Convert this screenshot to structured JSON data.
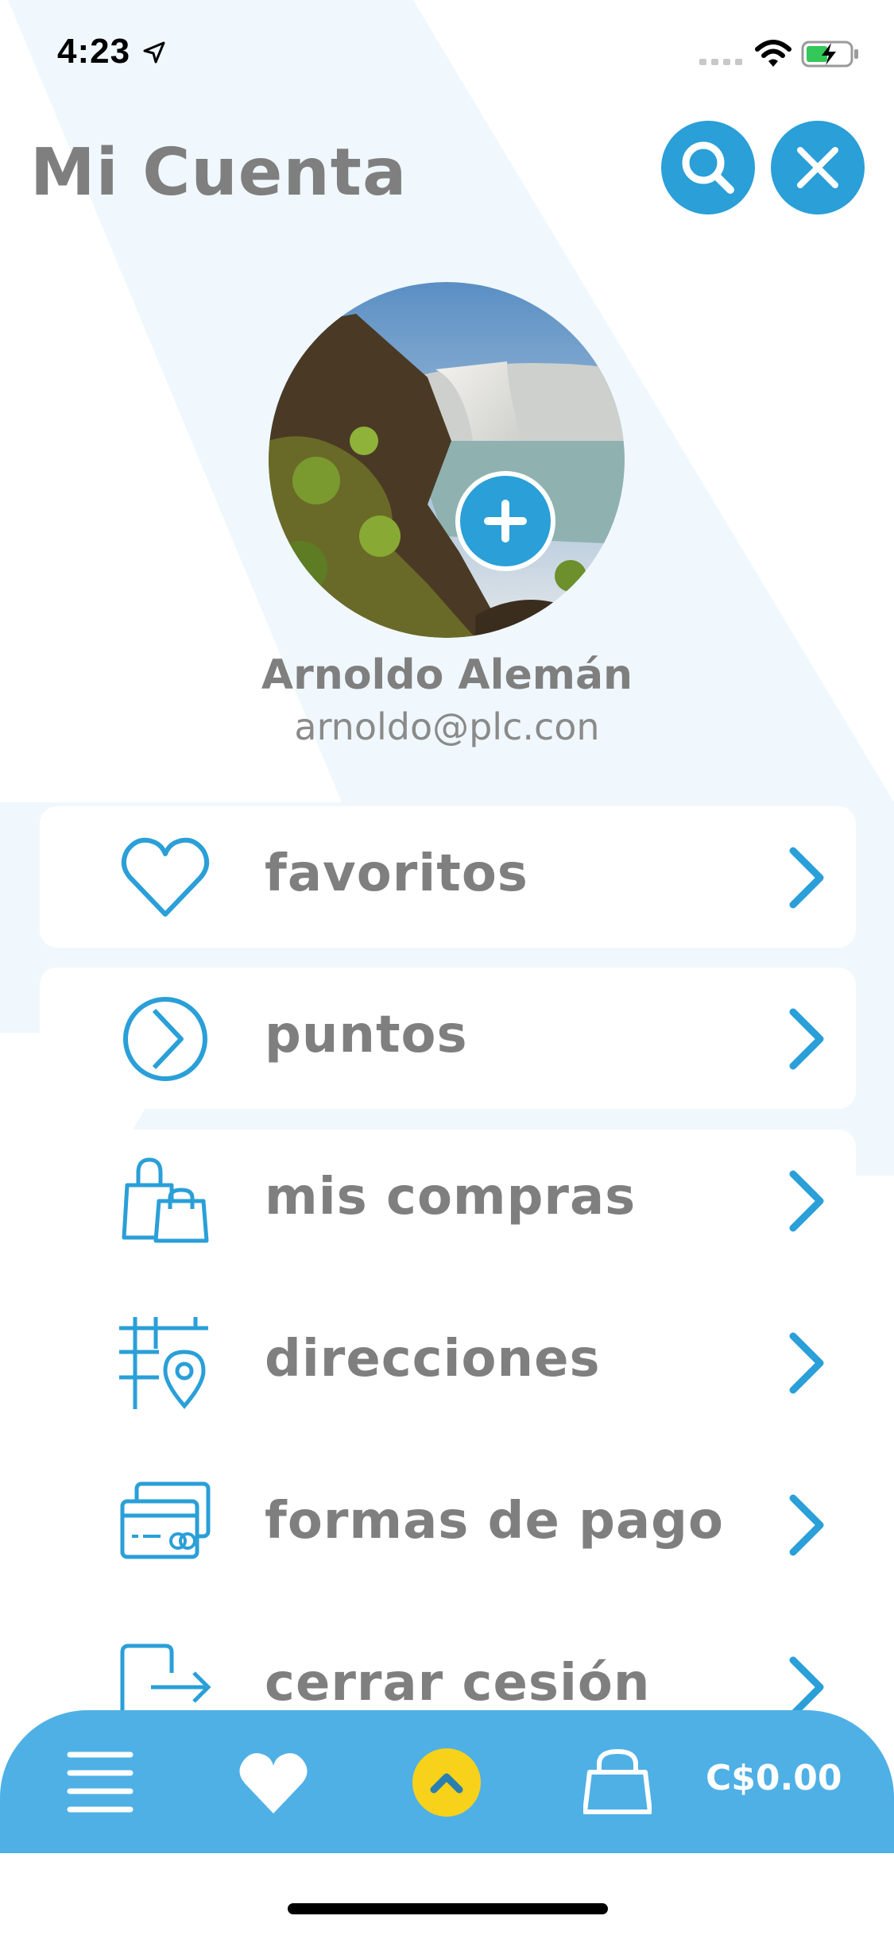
{
  "status_bar": {
    "time": "4:23"
  },
  "header": {
    "title": "Mi Cuenta"
  },
  "profile": {
    "name": "Arnoldo Alemán",
    "email": "arnoldo@plc.con"
  },
  "menu": [
    {
      "label": "favoritos",
      "icon": "heart-outline-icon"
    },
    {
      "label": "puntos",
      "icon": "points-circle-icon"
    },
    {
      "label": "mis compras",
      "icon": "shopping-bags-icon"
    },
    {
      "label": "direcciones",
      "icon": "map-pin-icon"
    },
    {
      "label": "formas de pago",
      "icon": "credit-cards-icon"
    },
    {
      "label": "cerrar cesión",
      "icon": "logout-icon"
    }
  ],
  "bottom_nav": {
    "cart_total": "C$0.00"
  },
  "colors": {
    "accent": "#2a9fd8",
    "bar": "#4fb0e6",
    "text": "#7f7f7f",
    "center_button": "#f8d21a"
  }
}
